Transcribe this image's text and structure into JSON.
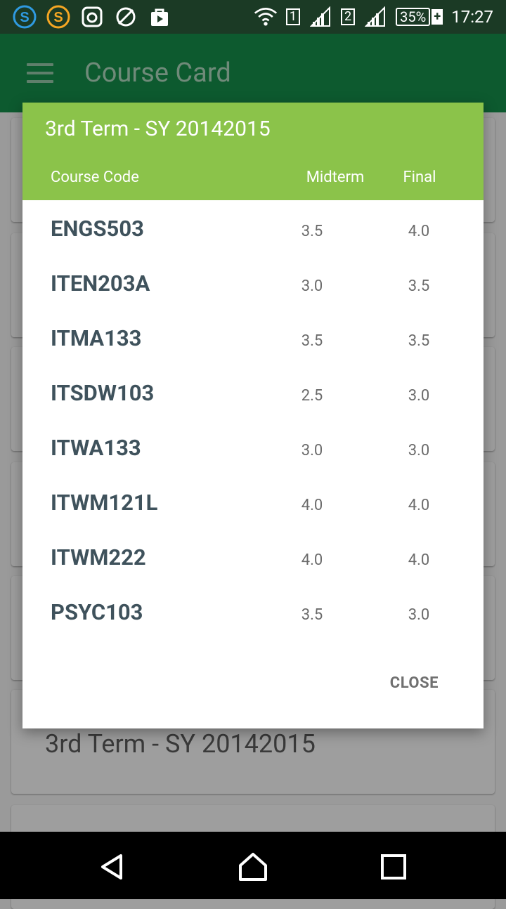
{
  "status_bar": {
    "time": "17:27",
    "battery": "35%",
    "sim1": "1",
    "sim2": "2",
    "icons": [
      "skype-icon",
      "s-app-icon",
      "instagram-icon",
      "vpn-globe-icon",
      "bag-icon",
      "wifi-icon",
      "signal-icon",
      "battery-icon"
    ]
  },
  "app_bar": {
    "title": "Course Card",
    "menu_icon": "hamburger-menu-icon"
  },
  "background": {
    "term_label": "3rd Term - SY 20142015"
  },
  "dialog": {
    "title": "3rd Term - SY 20142015",
    "columns": {
      "code": "Course Code",
      "midterm": "Midterm",
      "final": "Final"
    },
    "rows": [
      {
        "code": "ENGS503",
        "midterm": "3.5",
        "final": "4.0"
      },
      {
        "code": "ITEN203A",
        "midterm": "3.0",
        "final": "3.5"
      },
      {
        "code": "ITMA133",
        "midterm": "3.5",
        "final": "3.5"
      },
      {
        "code": "ITSDW103",
        "midterm": "2.5",
        "final": "3.0"
      },
      {
        "code": "ITWA133",
        "midterm": "3.0",
        "final": "3.0"
      },
      {
        "code": "ITWM121L",
        "midterm": "4.0",
        "final": "4.0"
      },
      {
        "code": "ITWM222",
        "midterm": "4.0",
        "final": "4.0"
      },
      {
        "code": "PSYC103",
        "midterm": "3.5",
        "final": "3.0"
      }
    ],
    "close_label": "CLOSE"
  },
  "colors": {
    "header_green": "#8bc34a",
    "appbar_green": "#0d5a2f",
    "statusbar": "#1b3a25"
  },
  "nav_bar": {
    "icons": [
      "back-icon",
      "home-icon",
      "recents-icon"
    ]
  }
}
